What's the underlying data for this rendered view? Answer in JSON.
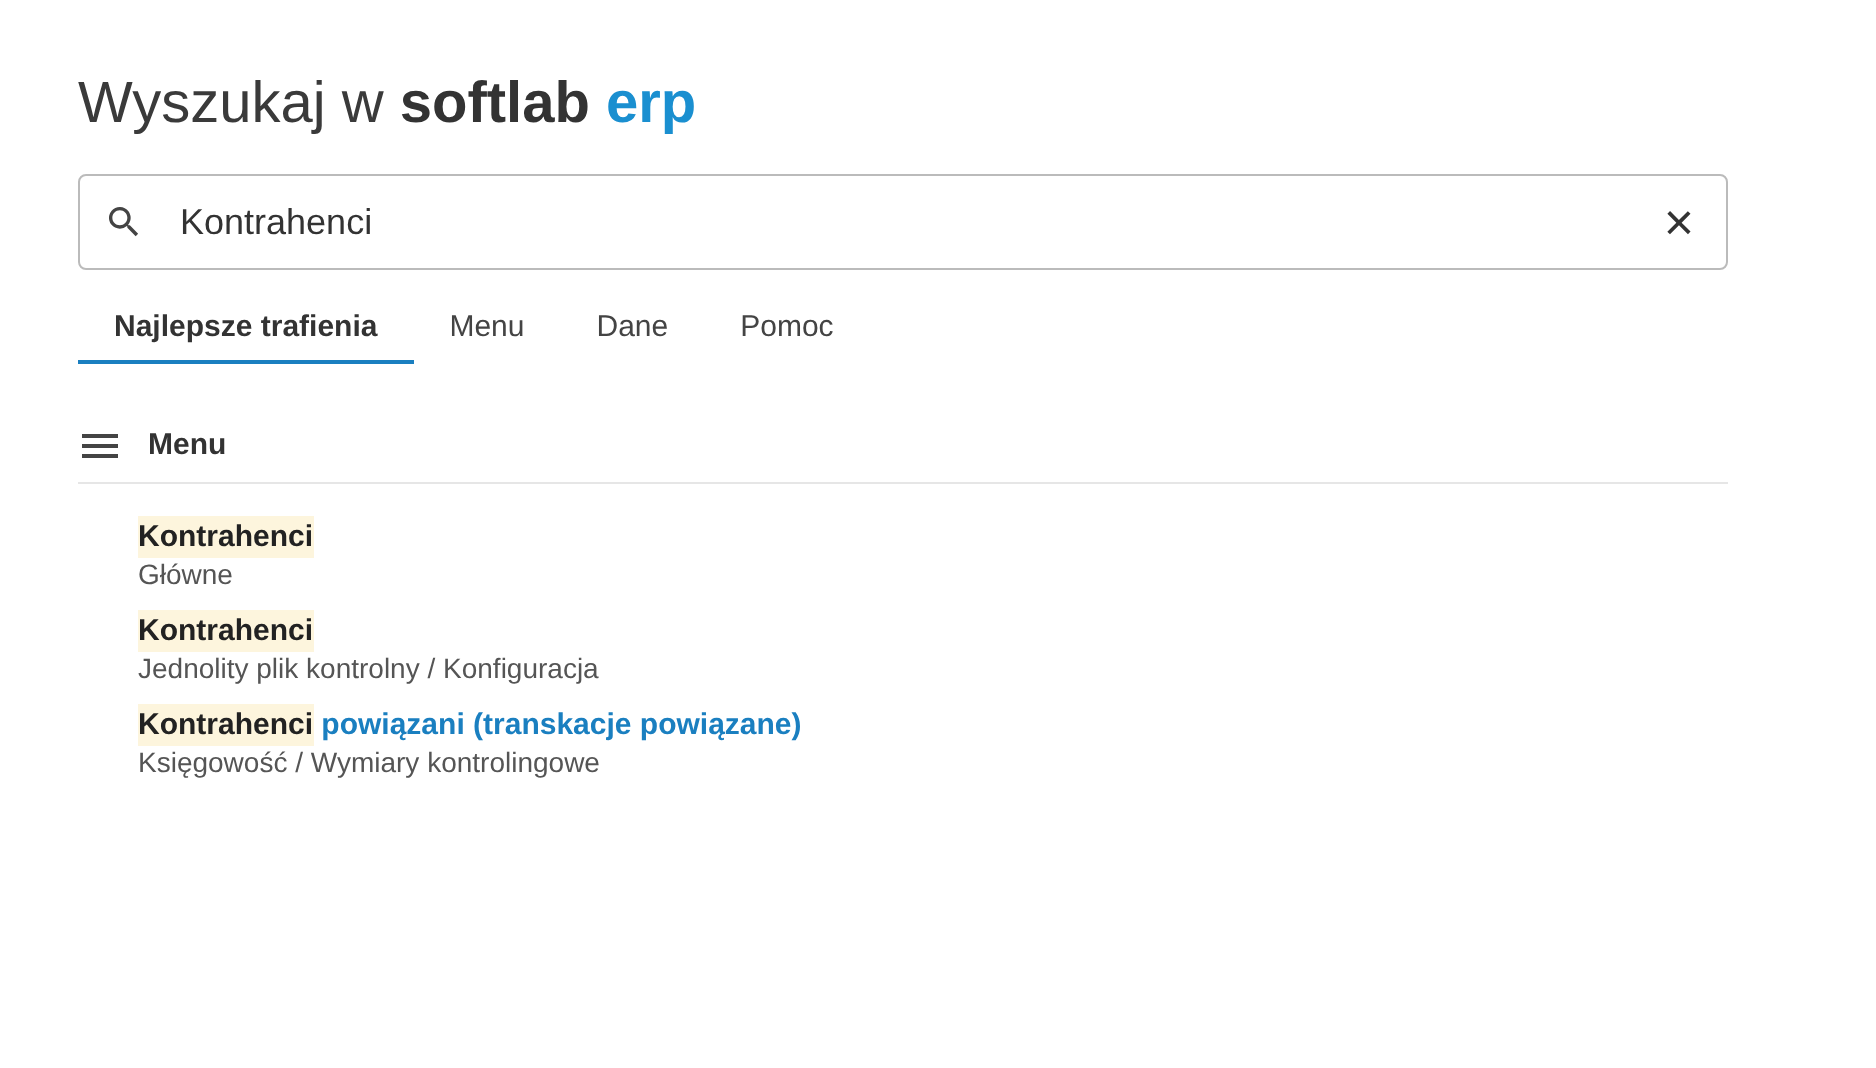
{
  "heading": {
    "prefix": "Wyszukaj w",
    "brand": "softlab",
    "suffix": "erp"
  },
  "search": {
    "value": "Kontrahenci",
    "clear": "×"
  },
  "tabs": [
    {
      "label": "Najlepsze trafienia",
      "selected": true
    },
    {
      "label": "Menu",
      "selected": false
    },
    {
      "label": "Dane",
      "selected": false
    },
    {
      "label": "Pomoc",
      "selected": false
    }
  ],
  "section": {
    "title": "Menu"
  },
  "results": [
    {
      "match": "Kontrahenci",
      "path": "Główne"
    },
    {
      "match": "Kontrahenci",
      "path": "Jednolity plik kontrolny / Konfiguracja"
    },
    {
      "match": "Kontrahenci",
      "rest": " powiązani (transkacje powiązane)",
      "path": "Księgowość / Wymiary kontrolingowe"
    }
  ]
}
